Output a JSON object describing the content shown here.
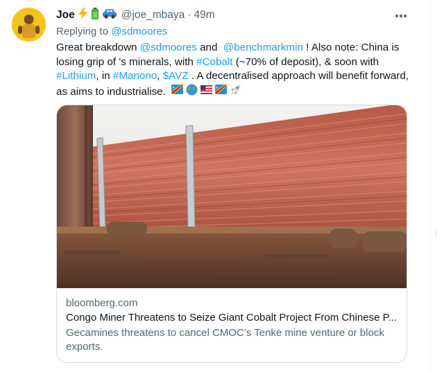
{
  "tweet": {
    "author": {
      "display_name": "Joe",
      "emojis": [
        "lightning-emoji",
        "battery-emoji",
        "car-emoji"
      ],
      "handle": "@joe_mbaya",
      "separator": "·",
      "time": "49m"
    },
    "more_icon": "more-horizontal-icon",
    "replying_prefix": "Replying to",
    "replying_to": "@sdmoores",
    "text": {
      "p1": "Great breakdown",
      "m1": "@sdmoores",
      "p2": "and",
      "m2": "@benchmarkmin",
      "p3": "! Also note: China is losing grip of 's minerals, with",
      "h1": "#Cobalt",
      "p4": "(~70% of  deposit), & soon with",
      "h2": "#Lithium",
      "p5": ", in",
      "h3": "#Manono",
      "p6": ",",
      "h4": "$AVZ",
      "p7": ". A decentralised approach will benefit forward, as  aims to industrialise.",
      "trailing_emojis": [
        "drc-flag-emoji",
        "globe-emoji",
        "us-flag-emoji",
        "drc-flag-emoji",
        "rocket-emoji"
      ]
    },
    "card": {
      "image": "copper-cathode-sheets-photo",
      "domain": "bloomberg.com",
      "title": "Congo Miner Threatens to Seize Giant Cobalt Project From Chinese P...",
      "description": "Gecamines threatens to cancel CMOC’s Tenke mine venture or block exports."
    }
  },
  "colors": {
    "link": "#1d9bf0",
    "secondary_text": "#536471",
    "primary_text": "#0f1419",
    "border": "#cfd9de",
    "copper": "#c0614a"
  }
}
